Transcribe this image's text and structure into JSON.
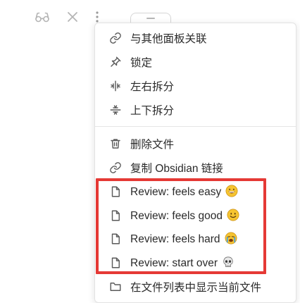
{
  "menu": {
    "items": [
      {
        "label": "与其他面板关联",
        "icon": "link-icon"
      },
      {
        "label": "锁定",
        "icon": "pin-icon"
      },
      {
        "label": "左右拆分",
        "icon": "split-vertical-icon"
      },
      {
        "label": "上下拆分",
        "icon": "split-horizontal-icon"
      },
      {
        "label": "删除文件",
        "icon": "trash-icon"
      },
      {
        "label": "复制 Obsidian 链接",
        "icon": "link-icon"
      },
      {
        "label": "Review: feels easy",
        "icon": "file-icon",
        "emoji": "grinning-face-emoji"
      },
      {
        "label": "Review: feels good",
        "icon": "file-icon",
        "emoji": "smiling-face-emoji"
      },
      {
        "label": "Review: feels hard",
        "icon": "file-icon",
        "emoji": "crying-face-emoji"
      },
      {
        "label": "Review: start over",
        "icon": "file-icon",
        "emoji": "skull-emoji"
      },
      {
        "label": "在文件列表中显示当前文件",
        "icon": "folder-icon"
      }
    ]
  },
  "toolbar": {
    "icons": [
      "glasses-icon",
      "close-icon",
      "more-vertical-icon"
    ]
  },
  "highlight_color": "#e53935"
}
